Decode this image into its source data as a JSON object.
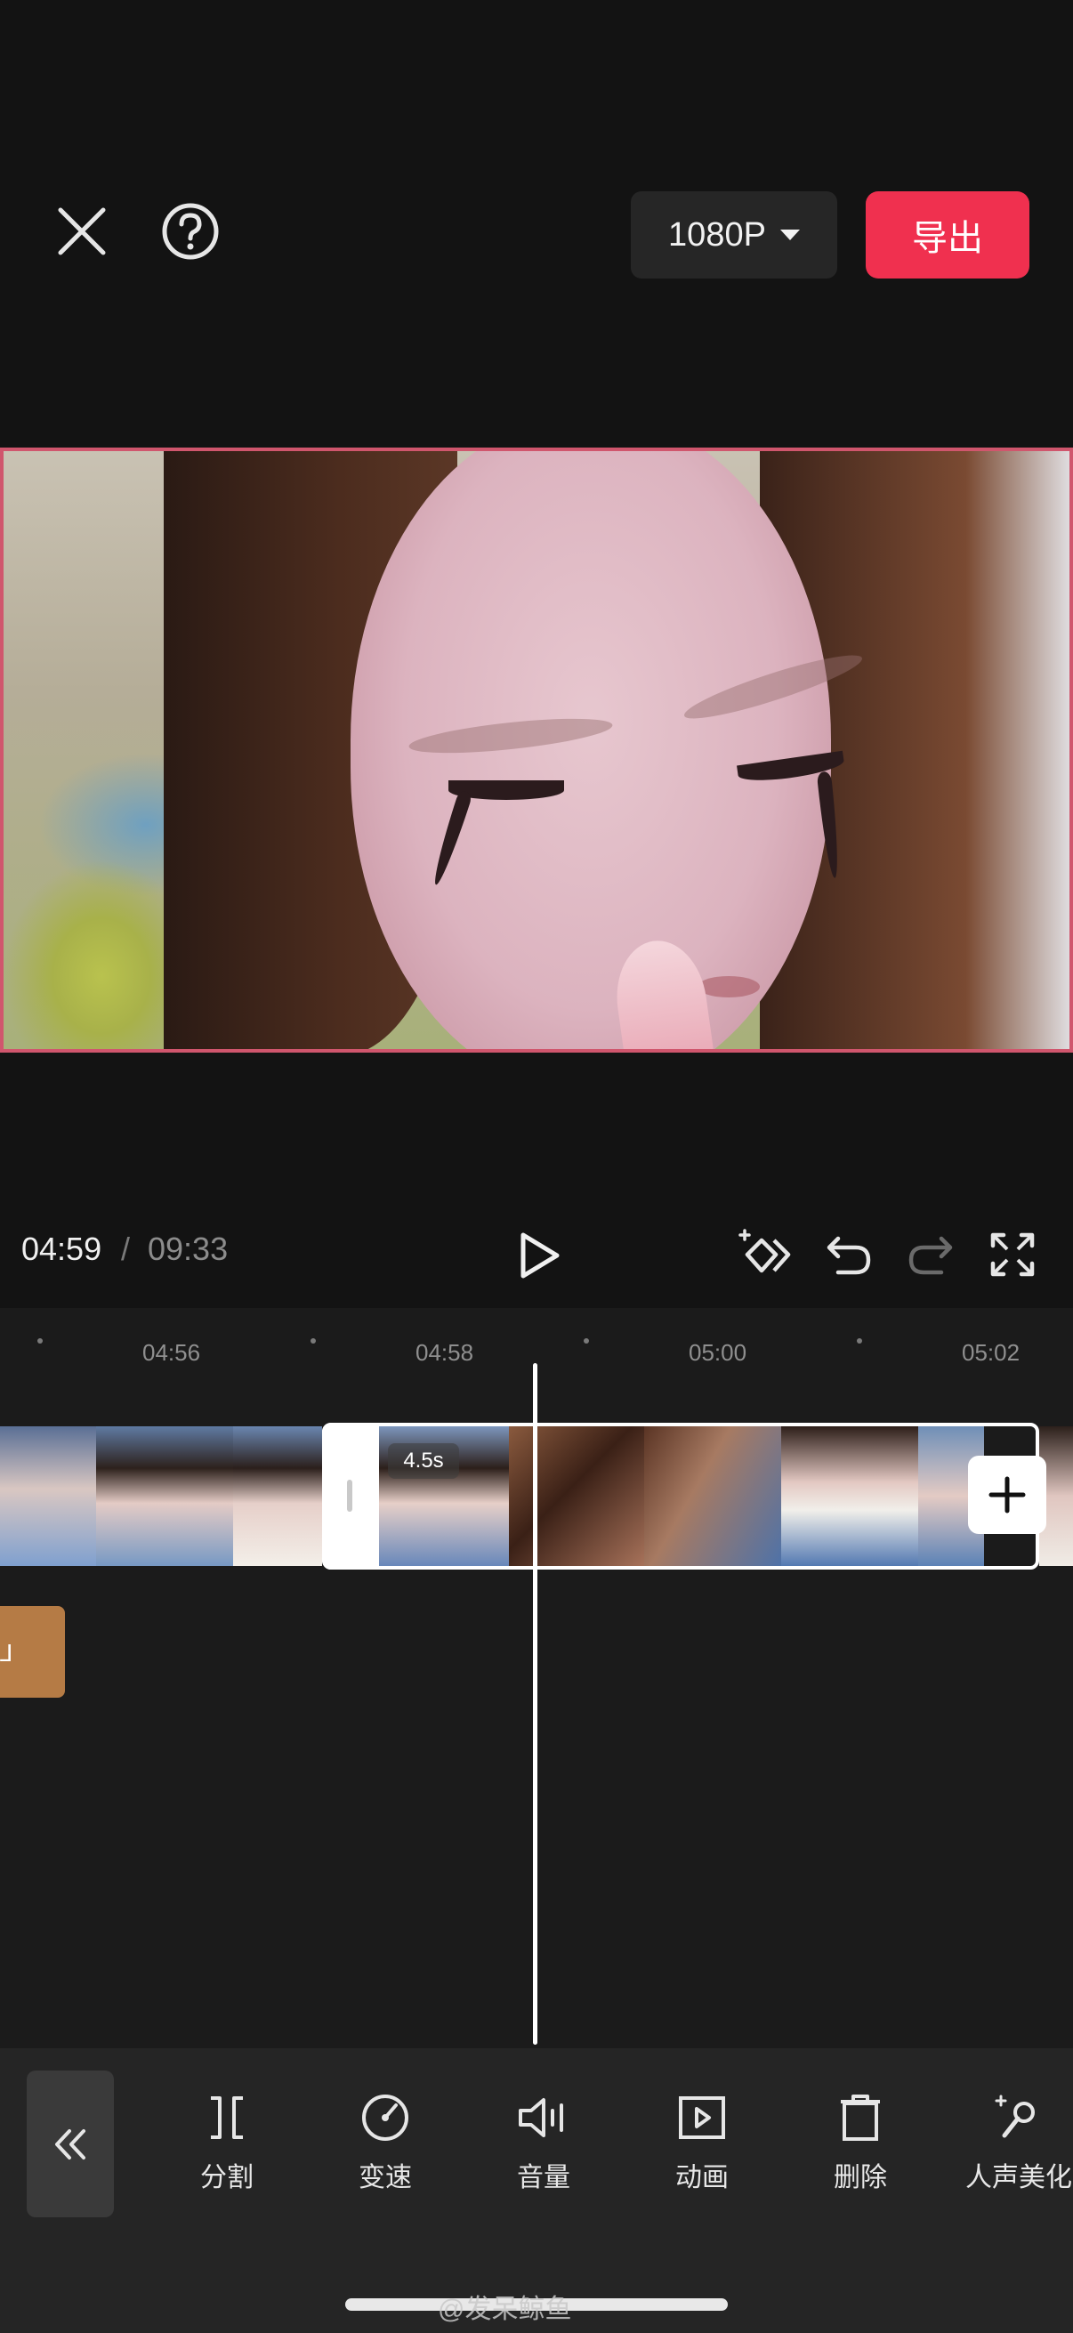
{
  "header": {
    "resolution_label": "1080P",
    "export_label": "导出"
  },
  "playback": {
    "current_time": "04:59",
    "separator": "/",
    "total_time": "09:33"
  },
  "timeline": {
    "ruler_labels": [
      "04:56",
      "04:58",
      "05:00",
      "05:02"
    ],
    "selected_clip_duration": "4.5s",
    "audio_clip_label": "⅃"
  },
  "toolbar": {
    "items": [
      {
        "label": "分割",
        "icon": "split-icon"
      },
      {
        "label": "变速",
        "icon": "speed-icon"
      },
      {
        "label": "音量",
        "icon": "volume-icon"
      },
      {
        "label": "动画",
        "icon": "animation-icon"
      },
      {
        "label": "删除",
        "icon": "delete-icon"
      },
      {
        "label": "人声美化",
        "icon": "voice-enhance-icon"
      }
    ]
  },
  "watermark": "@发呆鲸鱼",
  "colors": {
    "accent": "#f0304f",
    "background": "#131313",
    "audio_clip": "#b57b45",
    "preview_border": "#d0566d"
  }
}
